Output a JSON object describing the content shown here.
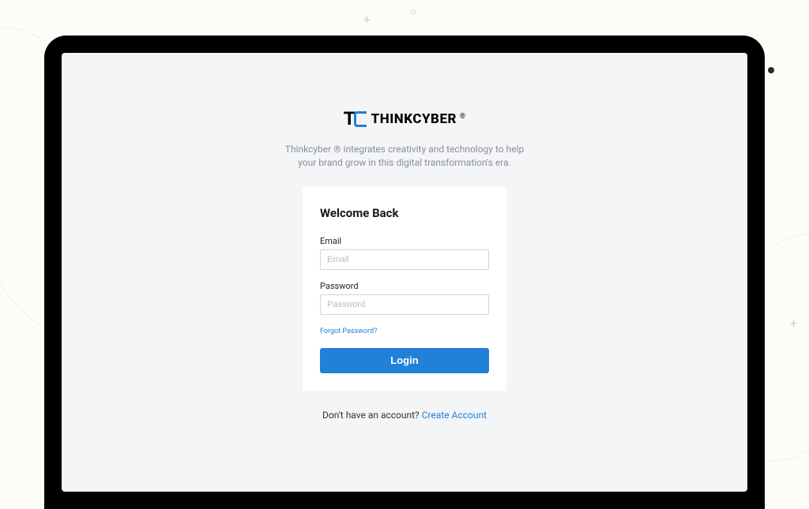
{
  "brand": {
    "name": "THINKCYBER",
    "reg": "®",
    "tagline": "Thinkcyber ® integrates creativity and technology to help your brand grow in this digital transformation's era."
  },
  "login": {
    "title": "Welcome Back",
    "email_label": "Email",
    "email_placeholder": "Email",
    "password_label": "Password",
    "password_placeholder": "Password",
    "forgot_label": "Forgot Password?",
    "submit_label": "Login"
  },
  "signup": {
    "prompt": "Don't have an account? ",
    "link_label": "Create Account"
  },
  "colors": {
    "primary": "#2180d8",
    "screen_bg": "#f3f5f7",
    "page_bg": "#fdfcf8"
  }
}
